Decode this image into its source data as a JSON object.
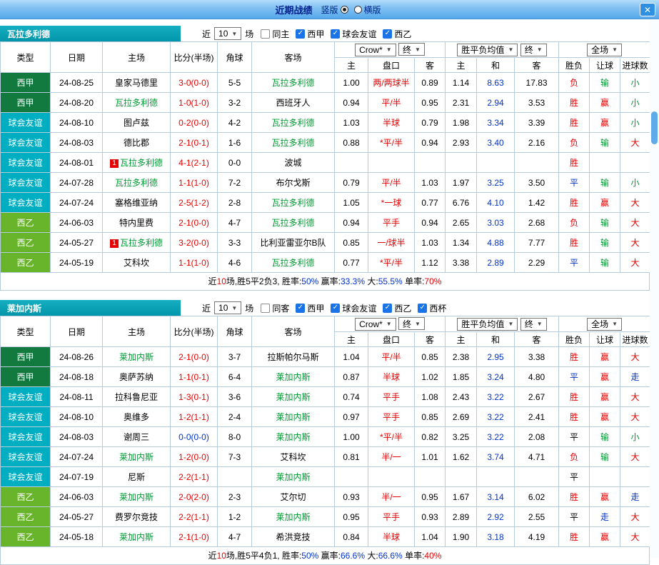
{
  "titlebar": {
    "title": "近期战绩",
    "view_options": [
      {
        "label": "竖版",
        "state_class": "checked"
      },
      {
        "label": "横版",
        "state_class": "unchecked"
      }
    ]
  },
  "icons": {
    "dropdown_arrow": "▼",
    "checkmark": "✓",
    "close": "✕"
  },
  "colors": {
    "titlebar_blue": "#55a8ea",
    "header_teal": "#0295a9",
    "laliga_green": "#127a3e",
    "friendly_teal": "#00aec2",
    "segunda_green": "#68b52b",
    "win_red": "#e60000",
    "self_team_green": "#009933",
    "draw_blue": "#0033cc"
  },
  "columns": {
    "type": "类型",
    "date": "日期",
    "home": "主场",
    "score": "比分(半场)",
    "corner": "角球",
    "away": "客场",
    "odds_home": "主",
    "handicap": "盘口",
    "odds_away": "客",
    "avg_home": "主",
    "avg_draw": "和",
    "avg_away": "客",
    "result": "胜负",
    "handicap_result": "让球",
    "goals": "进球数"
  },
  "sections": [
    {
      "team": "瓦拉多利德",
      "filters": {
        "near_label": "近",
        "count": "10",
        "games_label": "场",
        "checkboxes": [
          {
            "label": "同主",
            "state_class": "unchecked"
          },
          {
            "label": "西甲",
            "state_class": "checked"
          },
          {
            "label": "球会友谊",
            "state_class": "checked"
          },
          {
            "label": "西乙",
            "state_class": "checked"
          }
        ]
      },
      "dropdowns": {
        "company": "Crow*",
        "final1": "终",
        "avg": "胜平负均值",
        "final2": "终",
        "scope": "全场"
      },
      "rows": [
        {
          "type": "西甲",
          "type_class": "t-liga",
          "date": "24-08-25",
          "home_badge": "",
          "home": "皇家马德里",
          "home_class": "",
          "score": "3-0(0-0)",
          "score_class": "c-red",
          "corner": "5-5",
          "away": "瓦拉多利德",
          "away_class": "c-green",
          "odds_home": "1.00",
          "handicap": "两/两球半",
          "odds_away": "0.89",
          "avg_home": "1.14",
          "avg_draw": "8.63",
          "avg_away": "17.83",
          "result": "负",
          "result_class": "c-red",
          "let_result": "输",
          "let_class": "c-green",
          "goal_result": "小",
          "goal_class": "c-green"
        },
        {
          "type": "西甲",
          "type_class": "t-liga",
          "date": "24-08-20",
          "home_badge": "",
          "home": "瓦拉多利德",
          "home_class": "c-green",
          "score": "1-0(1-0)",
          "score_class": "c-red",
          "corner": "3-2",
          "away": "西班牙人",
          "away_class": "",
          "odds_home": "0.94",
          "handicap": "平/半",
          "odds_away": "0.95",
          "avg_home": "2.31",
          "avg_draw": "2.94",
          "avg_away": "3.53",
          "result": "胜",
          "result_class": "c-red",
          "let_result": "赢",
          "let_class": "c-red",
          "goal_result": "小",
          "goal_class": "c-green"
        },
        {
          "type": "球会友谊",
          "type_class": "t-friendly",
          "date": "24-08-10",
          "home_badge": "",
          "home": "图卢兹",
          "home_class": "",
          "score": "0-2(0-0)",
          "score_class": "c-red",
          "corner": "4-2",
          "away": "瓦拉多利德",
          "away_class": "c-green",
          "odds_home": "1.03",
          "handicap": "半球",
          "odds_away": "0.79",
          "avg_home": "1.98",
          "avg_draw": "3.34",
          "avg_away": "3.39",
          "result": "胜",
          "result_class": "c-red",
          "let_result": "赢",
          "let_class": "c-red",
          "goal_result": "小",
          "goal_class": "c-green"
        },
        {
          "type": "球会友谊",
          "type_class": "t-friendly",
          "date": "24-08-03",
          "home_badge": "",
          "home": "德比郡",
          "home_class": "",
          "score": "2-1(0-1)",
          "score_class": "c-red",
          "corner": "1-6",
          "away": "瓦拉多利德",
          "away_class": "c-green",
          "odds_home": "0.88",
          "handicap": "*平/半",
          "odds_away": "0.94",
          "avg_home": "2.93",
          "avg_draw": "3.40",
          "avg_away": "2.16",
          "result": "负",
          "result_class": "c-red",
          "let_result": "输",
          "let_class": "c-green",
          "goal_result": "大",
          "goal_class": "c-red"
        },
        {
          "type": "球会友谊",
          "type_class": "t-friendly",
          "date": "24-08-01",
          "home_badge": "1",
          "home": "瓦拉多利德",
          "home_class": "c-green",
          "score": "4-1(2-1)",
          "score_class": "c-red",
          "corner": "0-0",
          "away": "波城",
          "away_class": "",
          "odds_home": "",
          "handicap": "",
          "odds_away": "",
          "avg_home": "",
          "avg_draw": "",
          "avg_away": "",
          "result": "胜",
          "result_class": "c-red",
          "let_result": "",
          "let_class": "",
          "goal_result": "",
          "goal_class": ""
        },
        {
          "type": "球会友谊",
          "type_class": "t-friendly",
          "date": "24-07-28",
          "home_badge": "",
          "home": "瓦拉多利德",
          "home_class": "c-green",
          "score": "1-1(1-0)",
          "score_class": "c-red",
          "corner": "7-2",
          "away": "布尔戈斯",
          "away_class": "",
          "odds_home": "0.79",
          "handicap": "平/半",
          "odds_away": "1.03",
          "avg_home": "1.97",
          "avg_draw": "3.25",
          "avg_away": "3.50",
          "result": "平",
          "result_class": "c-blue",
          "let_result": "输",
          "let_class": "c-green",
          "goal_result": "小",
          "goal_class": "c-green"
        },
        {
          "type": "球会友谊",
          "type_class": "t-friendly",
          "date": "24-07-24",
          "home_badge": "",
          "home": "塞格维亚纳",
          "home_class": "",
          "score": "2-5(1-2)",
          "score_class": "c-red",
          "corner": "2-8",
          "away": "瓦拉多利德",
          "away_class": "c-green",
          "odds_home": "1.05",
          "handicap": "*一球",
          "odds_away": "0.77",
          "avg_home": "6.76",
          "avg_draw": "4.10",
          "avg_away": "1.42",
          "result": "胜",
          "result_class": "c-red",
          "let_result": "赢",
          "let_class": "c-red",
          "goal_result": "大",
          "goal_class": "c-red"
        },
        {
          "type": "西乙",
          "type_class": "t-segunda",
          "date": "24-06-03",
          "home_badge": "",
          "home": "特内里费",
          "home_class": "",
          "score": "2-1(0-0)",
          "score_class": "c-red",
          "corner": "4-7",
          "away": "瓦拉多利德",
          "away_class": "c-green",
          "odds_home": "0.94",
          "handicap": "平手",
          "odds_away": "0.94",
          "avg_home": "2.65",
          "avg_draw": "3.03",
          "avg_away": "2.68",
          "result": "负",
          "result_class": "c-red",
          "let_result": "输",
          "let_class": "c-green",
          "goal_result": "大",
          "goal_class": "c-red"
        },
        {
          "type": "西乙",
          "type_class": "t-segunda",
          "date": "24-05-27",
          "home_badge": "1",
          "home": "瓦拉多利德",
          "home_class": "c-green",
          "score": "3-2(0-0)",
          "score_class": "c-red",
          "corner": "3-3",
          "away": "比利亚雷亚尔B队",
          "away_class": "",
          "odds_home": "0.85",
          "handicap": "一/球半",
          "odds_away": "1.03",
          "avg_home": "1.34",
          "avg_draw": "4.88",
          "avg_away": "7.77",
          "result": "胜",
          "result_class": "c-red",
          "let_result": "输",
          "let_class": "c-green",
          "goal_result": "大",
          "goal_class": "c-red"
        },
        {
          "type": "西乙",
          "type_class": "t-segunda",
          "date": "24-05-19",
          "home_badge": "",
          "home": "艾科坎",
          "home_class": "",
          "score": "1-1(1-0)",
          "score_class": "c-red",
          "corner": "4-6",
          "away": "瓦拉多利德",
          "away_class": "c-green",
          "odds_home": "0.77",
          "handicap": "*平/半",
          "odds_away": "1.12",
          "avg_home": "3.38",
          "avg_draw": "2.89",
          "avg_away": "2.29",
          "result": "平",
          "result_class": "c-blue",
          "let_result": "输",
          "let_class": "c-green",
          "goal_result": "大",
          "goal_class": "c-red"
        }
      ],
      "summary": [
        {
          "text": "近",
          "class": "c-black"
        },
        {
          "text": "10",
          "class": "c-red"
        },
        {
          "text": "场,胜5平2负3, ",
          "class": "c-black"
        },
        {
          "text": "胜率:",
          "class": "c-black"
        },
        {
          "text": "50%",
          "class": "c-blue"
        },
        {
          "text": " 赢率:",
          "class": "c-black"
        },
        {
          "text": "33.3%",
          "class": "c-blue"
        },
        {
          "text": " 大:",
          "class": "c-black"
        },
        {
          "text": "55.5%",
          "class": "c-blue"
        },
        {
          "text": " 单率:",
          "class": "c-black"
        },
        {
          "text": "70%",
          "class": "c-red"
        }
      ]
    },
    {
      "team": "莱加内斯",
      "filters": {
        "near_label": "近",
        "count": "10",
        "games_label": "场",
        "checkboxes": [
          {
            "label": "同客",
            "state_class": "unchecked"
          },
          {
            "label": "西甲",
            "state_class": "checked"
          },
          {
            "label": "球会友谊",
            "state_class": "checked"
          },
          {
            "label": "西乙",
            "state_class": "checked"
          },
          {
            "label": "西杯",
            "state_class": "checked"
          }
        ]
      },
      "dropdowns": {
        "company": "Crow*",
        "final1": "终",
        "avg": "胜平负均值",
        "final2": "终",
        "scope": "全场"
      },
      "rows": [
        {
          "type": "西甲",
          "type_class": "t-liga",
          "date": "24-08-26",
          "home_badge": "",
          "home": "莱加内斯",
          "home_class": "c-green",
          "score": "2-1(0-0)",
          "score_class": "c-red",
          "corner": "3-7",
          "away": "拉斯帕尔马斯",
          "away_class": "",
          "odds_home": "1.04",
          "handicap": "平/半",
          "odds_away": "0.85",
          "avg_home": "2.38",
          "avg_draw": "2.95",
          "avg_away": "3.38",
          "result": "胜",
          "result_class": "c-red",
          "let_result": "赢",
          "let_class": "c-red",
          "goal_result": "大",
          "goal_class": "c-red"
        },
        {
          "type": "西甲",
          "type_class": "t-liga",
          "date": "24-08-18",
          "home_badge": "",
          "home": "奥萨苏纳",
          "home_class": "",
          "score": "1-1(0-1)",
          "score_class": "c-red",
          "corner": "6-4",
          "away": "莱加内斯",
          "away_class": "c-green",
          "odds_home": "0.87",
          "handicap": "半球",
          "odds_away": "1.02",
          "avg_home": "1.85",
          "avg_draw": "3.24",
          "avg_away": "4.80",
          "result": "平",
          "result_class": "c-blue",
          "let_result": "赢",
          "let_class": "c-red",
          "goal_result": "走",
          "goal_class": "c-blue"
        },
        {
          "type": "球会友谊",
          "type_class": "t-friendly",
          "date": "24-08-11",
          "home_badge": "",
          "home": "拉科鲁尼亚",
          "home_class": "",
          "score": "1-3(0-1)",
          "score_class": "c-red",
          "corner": "3-6",
          "away": "莱加内斯",
          "away_class": "c-green",
          "odds_home": "0.74",
          "handicap": "平手",
          "odds_away": "1.08",
          "avg_home": "2.43",
          "avg_draw": "3.22",
          "avg_away": "2.67",
          "result": "胜",
          "result_class": "c-red",
          "let_result": "赢",
          "let_class": "c-red",
          "goal_result": "大",
          "goal_class": "c-red"
        },
        {
          "type": "球会友谊",
          "type_class": "t-friendly",
          "date": "24-08-10",
          "home_badge": "",
          "home": "奥维多",
          "home_class": "",
          "score": "1-2(1-1)",
          "score_class": "c-red",
          "corner": "2-4",
          "away": "莱加内斯",
          "away_class": "c-green",
          "odds_home": "0.97",
          "handicap": "平手",
          "odds_away": "0.85",
          "avg_home": "2.69",
          "avg_draw": "3.22",
          "avg_away": "2.41",
          "result": "胜",
          "result_class": "c-red",
          "let_result": "赢",
          "let_class": "c-red",
          "goal_result": "大",
          "goal_class": "c-red"
        },
        {
          "type": "球会友谊",
          "type_class": "t-friendly",
          "date": "24-08-03",
          "home_badge": "",
          "home": "谢周三",
          "home_class": "",
          "score": "0-0(0-0)",
          "score_class": "c-blue",
          "corner": "8-0",
          "away": "莱加内斯",
          "away_class": "c-green",
          "odds_home": "1.00",
          "handicap": "*平/半",
          "odds_away": "0.82",
          "avg_home": "3.25",
          "avg_draw": "3.22",
          "avg_away": "2.08",
          "result": "平",
          "result_class": "c-black",
          "let_result": "输",
          "let_class": "c-green",
          "goal_result": "小",
          "goal_class": "c-green"
        },
        {
          "type": "球会友谊",
          "type_class": "t-friendly",
          "date": "24-07-24",
          "home_badge": "",
          "home": "莱加内斯",
          "home_class": "c-green",
          "score": "1-2(0-0)",
          "score_class": "c-red",
          "corner": "7-3",
          "away": "艾科坎",
          "away_class": "",
          "odds_home": "0.81",
          "handicap": "半/一",
          "odds_away": "1.01",
          "avg_home": "1.62",
          "avg_draw": "3.74",
          "avg_away": "4.71",
          "result": "负",
          "result_class": "c-red",
          "let_result": "输",
          "let_class": "c-green",
          "goal_result": "大",
          "goal_class": "c-red"
        },
        {
          "type": "球会友谊",
          "type_class": "t-friendly",
          "date": "24-07-19",
          "home_badge": "",
          "home": "尼斯",
          "home_class": "",
          "score": "2-2(1-1)",
          "score_class": "c-red",
          "corner": "",
          "away": "莱加内斯",
          "away_class": "c-green",
          "odds_home": "",
          "handicap": "",
          "odds_away": "",
          "avg_home": "",
          "avg_draw": "",
          "avg_away": "",
          "result": "平",
          "result_class": "c-black",
          "let_result": "",
          "let_class": "",
          "goal_result": "",
          "goal_class": ""
        },
        {
          "type": "西乙",
          "type_class": "t-segunda",
          "date": "24-06-03",
          "home_badge": "",
          "home": "莱加内斯",
          "home_class": "c-green",
          "score": "2-0(2-0)",
          "score_class": "c-red",
          "corner": "2-3",
          "away": "艾尔切",
          "away_class": "",
          "odds_home": "0.93",
          "handicap": "半/一",
          "odds_away": "0.95",
          "avg_home": "1.67",
          "avg_draw": "3.14",
          "avg_away": "6.02",
          "result": "胜",
          "result_class": "c-red",
          "let_result": "赢",
          "let_class": "c-red",
          "goal_result": "走",
          "goal_class": "c-blue"
        },
        {
          "type": "西乙",
          "type_class": "t-segunda",
          "date": "24-05-27",
          "home_badge": "",
          "home": "费罗尔竞技",
          "home_class": "",
          "score": "2-2(1-1)",
          "score_class": "c-red",
          "corner": "1-2",
          "away": "莱加内斯",
          "away_class": "c-green",
          "odds_home": "0.95",
          "handicap": "平手",
          "odds_away": "0.93",
          "avg_home": "2.89",
          "avg_draw": "2.92",
          "avg_away": "2.55",
          "result": "平",
          "result_class": "c-black",
          "let_result": "走",
          "let_class": "c-blue",
          "goal_result": "大",
          "goal_class": "c-red"
        },
        {
          "type": "西乙",
          "type_class": "t-segunda",
          "date": "24-05-18",
          "home_badge": "",
          "home": "莱加内斯",
          "home_class": "c-green",
          "score": "2-1(1-0)",
          "score_class": "c-red",
          "corner": "4-7",
          "away": "希洪竞技",
          "away_class": "",
          "odds_home": "0.84",
          "handicap": "半球",
          "odds_away": "1.04",
          "avg_home": "1.90",
          "avg_draw": "3.18",
          "avg_away": "4.19",
          "result": "胜",
          "result_class": "c-red",
          "let_result": "赢",
          "let_class": "c-red",
          "goal_result": "大",
          "goal_class": "c-red"
        }
      ],
      "summary": [
        {
          "text": "近",
          "class": "c-black"
        },
        {
          "text": "10",
          "class": "c-red"
        },
        {
          "text": "场,胜5平4负1, ",
          "class": "c-black"
        },
        {
          "text": "胜率:",
          "class": "c-black"
        },
        {
          "text": "50%",
          "class": "c-blue"
        },
        {
          "text": " 赢率:",
          "class": "c-black"
        },
        {
          "text": "66.6%",
          "class": "c-blue"
        },
        {
          "text": " 大:",
          "class": "c-black"
        },
        {
          "text": "66.6%",
          "class": "c-blue"
        },
        {
          "text": " 单率:",
          "class": "c-black"
        },
        {
          "text": "40%",
          "class": "c-red"
        }
      ]
    }
  ]
}
